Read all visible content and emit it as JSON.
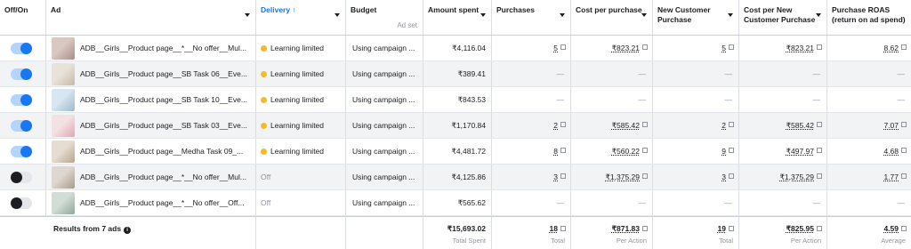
{
  "headers": {
    "off_on": "Off/On",
    "ad": "Ad",
    "delivery": "Delivery",
    "delivery_arrow": "↑",
    "budget": "Budget",
    "budget_sub": "Ad set",
    "amount_spent": "Amount spent",
    "purchases": "Purchases",
    "cost_per_purchase": "Cost per purchase",
    "new_customer_purchase": "New Customer Purchase",
    "cost_per_new_customer": "Cost per New Customer Purchase",
    "purchase_roas": "Purchase ROAS (return on ad spend)"
  },
  "rows": [
    {
      "toggle": "on",
      "ad": "ADB__Girls__Product page__*__No offer__Mul...",
      "delivery": "Learning limited",
      "delivery_status": "learning",
      "budget": "Using campaign ...",
      "amount": "₹4,116.04",
      "purchases": "5",
      "cpp": "₹823.21",
      "ncp": "5",
      "cpncp": "₹823.21",
      "roas": "8.62"
    },
    {
      "toggle": "on",
      "ad": "ADB__Girls__Product page__SB Task 06__Eve...",
      "delivery": "Learning limited",
      "delivery_status": "learning",
      "budget": "Using campaign ...",
      "amount": "₹389.41",
      "purchases": "—",
      "cpp": "—",
      "ncp": "—",
      "cpncp": "—",
      "roas": "—"
    },
    {
      "toggle": "on",
      "ad": "ADB__Girls__Product page__SB Task 10__Eve...",
      "delivery": "Learning limited",
      "delivery_status": "learning",
      "budget": "Using campaign ...",
      "amount": "₹843.53",
      "purchases": "—",
      "cpp": "—",
      "ncp": "—",
      "cpncp": "—",
      "roas": "—"
    },
    {
      "toggle": "on",
      "ad": "ADB__Girls__Product page__SB Task 03__Eve...",
      "delivery": "Learning limited",
      "delivery_status": "learning",
      "budget": "Using campaign ...",
      "amount": "₹1,170.84",
      "purchases": "2",
      "cpp": "₹585.42",
      "ncp": "2",
      "cpncp": "₹585.42",
      "roas": "7.07"
    },
    {
      "toggle": "on",
      "ad": "ADB__Girls__Product page__Medha Task 09_...",
      "delivery": "Learning limited",
      "delivery_status": "learning",
      "budget": "Using campaign ...",
      "amount": "₹4,481.72",
      "purchases": "8",
      "cpp": "₹560.22",
      "ncp": "9",
      "cpncp": "₹497.97",
      "roas": "4.68"
    },
    {
      "toggle": "off",
      "ad": "ADB__Girls__Product page__*__No offer__Mul...",
      "delivery": "Off",
      "delivery_status": "off",
      "budget": "Using campaign ...",
      "amount": "₹4,125.86",
      "purchases": "3",
      "cpp": "₹1,375.29",
      "ncp": "3",
      "cpncp": "₹1,375.29",
      "roas": "1.77"
    },
    {
      "toggle": "off",
      "ad": "ADB__Girls__Product page__*__No offer__Off...",
      "delivery": "Off",
      "delivery_status": "off",
      "budget": "Using campaign ...",
      "amount": "₹565.62",
      "purchases": "—",
      "cpp": "—",
      "ncp": "—",
      "cpncp": "—",
      "roas": "—"
    }
  ],
  "totals": {
    "label": "Results from 7 ads",
    "amount": "₹15,693.02",
    "amount_sub": "Total Spent",
    "purchases": "18",
    "purchases_sub": "Total",
    "cpp": "₹871.83",
    "cpp_sub": "Per Action",
    "ncp": "19",
    "ncp_sub": "Total",
    "cpncp": "₹825.95",
    "cpncp_sub": "Per Action",
    "roas": "4.59",
    "roas_sub": "Average"
  },
  "colors": {
    "accent": "#1877f2",
    "learning_dot": "#f7b928",
    "toggle_on_track": "#b3d4fc"
  },
  "icons": {
    "sort_caret": "caret-down-icon",
    "info": "info-circle-icon",
    "sort_arrow": "arrow-up-icon"
  }
}
